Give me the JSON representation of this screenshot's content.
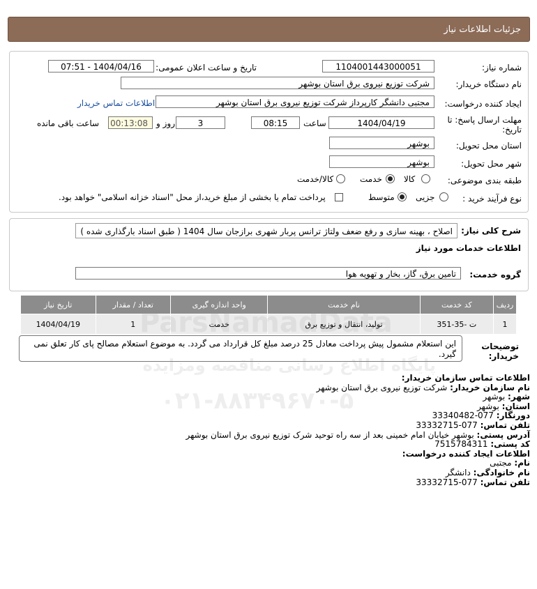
{
  "header": {
    "title": "جزئیات اطلاعات نیاز"
  },
  "form": {
    "need_number_label": "شماره نیاز:",
    "need_number": "1104001443000051",
    "announce_label": "تاریخ و ساعت اعلان عمومی:",
    "announce_value": "1404/04/16 - 07:51",
    "buyer_label": "نام دستگاه خریدار:",
    "buyer_value": "شرکت توزیع نیروی برق استان بوشهر",
    "creator_label": "ایجاد کننده درخواست:",
    "creator_value": "مجتبی دانشگر کارپرداز شرکت توزیع نیروی برق استان بوشهر",
    "contact_link": "اطلاعات تماس خریدار",
    "deadline_label_1": "مهلت ارسال پاسخ: تا",
    "deadline_label_2": "تاریخ:",
    "deadline_date": "1404/04/19",
    "time_label": "ساعت",
    "deadline_time": "08:15",
    "days_value": "3",
    "days_label": "روز و",
    "remaining_time": "00:13:08",
    "remaining_label": "ساعت باقی مانده",
    "province_label": "استان محل تحویل:",
    "province_value": "بوشهر",
    "city_label": "شهر محل تحویل:",
    "city_value": "بوشهر",
    "category_label": "طبقه بندی موضوعی:",
    "category_options": [
      "کالا",
      "خدمت",
      "کالا/خدمت"
    ],
    "category_selected": "خدمت",
    "process_label": "نوع فرآیند خرید :",
    "process_options": [
      "جزیی",
      "متوسط"
    ],
    "process_selected": "متوسط",
    "payment_text": "پرداخت تمام یا بخشی از مبلغ خرید،از محل \"اسناد خزانه اسلامی\" خواهد بود."
  },
  "description": {
    "label": "شرح کلی نیاز:",
    "value": "اصلاح ، بهینه سازی و رفع ضعف ولتاژ ترانس پربار شهری برازجان سال 1404 ( طبق اسناد بارگذاری شده )",
    "services_title": "اطلاعات خدمات مورد نیاز",
    "group_label": "گروه خدمت:",
    "group_value": "تامین برق، گاز، بخار و تهویه هوا"
  },
  "table": {
    "headers": [
      "ردیف",
      "کد خدمت",
      "نام خدمت",
      "واحد اندازه گیری",
      "تعداد / مقدار",
      "تاریخ نیاز"
    ],
    "rows": [
      [
        "1",
        "ت -35-351",
        "تولید، انتقال و توزیع برق",
        "خدمت",
        "1",
        "1404/04/19"
      ]
    ]
  },
  "notes": {
    "label": "توضیحات خریدار:",
    "value": "این استعلام مشمول پیش پرداخت معادل 25 درصد مبلغ کل قرارداد می گردد. به موضوع استعلام مصالح پای کار تعلق نمی گیرد."
  },
  "buyer_contact": {
    "title": "اطلاعات تماس سازمان خریدار:",
    "org_label": "نام سازمان خریدار:",
    "org_value": "شرکت توزیع نیروی برق استان بوشهر",
    "city_label": "شهر:",
    "city_value": "بوشهر",
    "province_label": "استان:",
    "province_value": "بوشهر",
    "fax_label": "دورنگار:",
    "fax_value": "077-33340482",
    "phone_label": "تلفن تماس:",
    "phone_value": "077-33332715",
    "address_label": "آدرس پستی:",
    "address_value": "بوشهر خیابان امام خمینی بعد از سه راه توحید شرک توزیع نیروی برق استان بوشهر",
    "postal_label": "کد پستی:",
    "postal_value": "7515784311"
  },
  "creator_contact": {
    "title": "اطلاعات ایجاد کننده درخواست:",
    "name_label": "نام:",
    "name_value": "مجتبی",
    "family_label": "نام خانوادگی:",
    "family_value": "دانشگر",
    "phone_label": "تلفن تماس:",
    "phone_value": "077-33332715"
  },
  "watermark": {
    "line1": "ParsNamadData",
    "line2": "پایگاه اطلاع رسانی مناقصه ومزایده",
    "line3": "۰۲۱-۸۸۳۴۹۶۷۰-۵"
  }
}
